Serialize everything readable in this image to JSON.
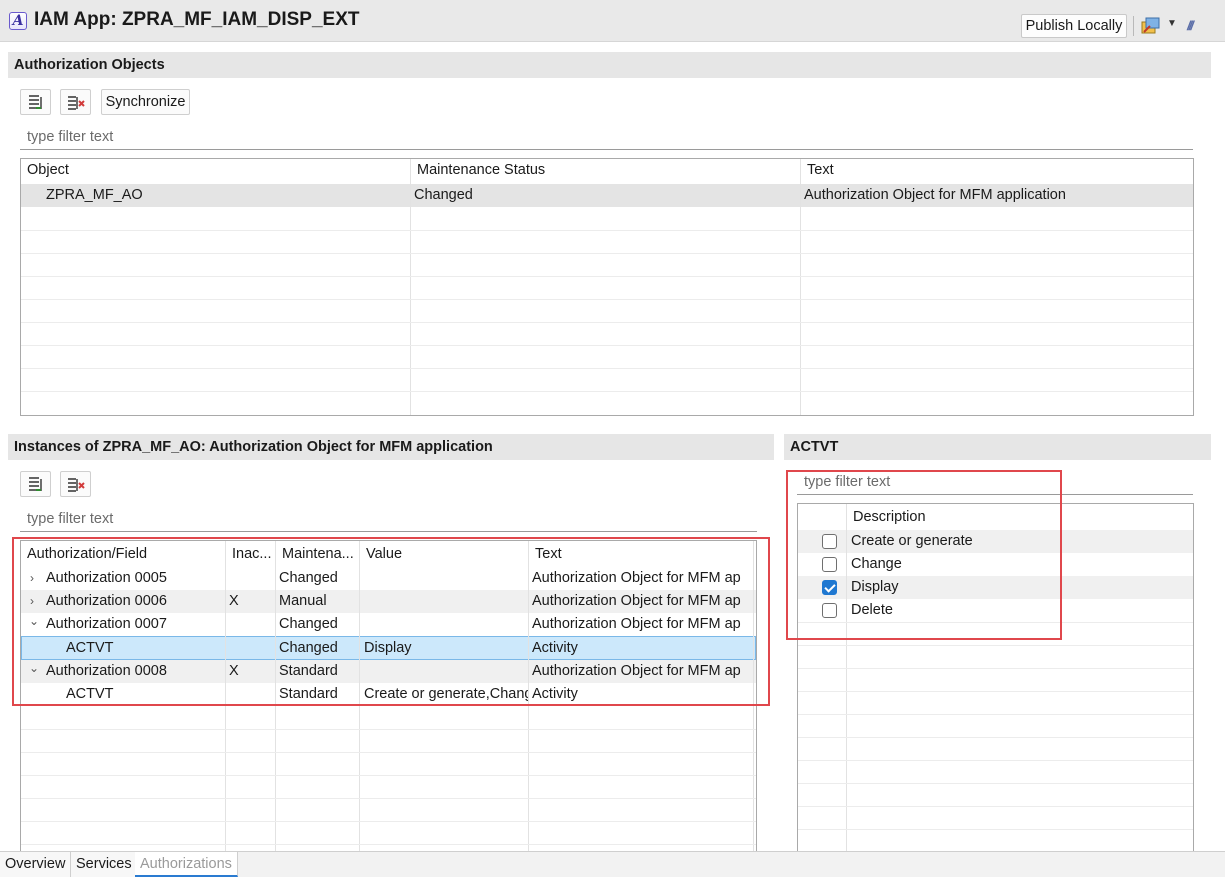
{
  "header": {
    "title": "IAM App: ZPRA_MF_IAM_DISP_EXT",
    "app_icon_letter": "A",
    "publish_label": "Publish Locally"
  },
  "auth_objects": {
    "section_title": "Authorization Objects",
    "synchronize_label": "Synchronize",
    "filter_placeholder": "type filter text",
    "columns": [
      "Object",
      "Maintenance Status",
      "Text"
    ],
    "rows": [
      {
        "object": "ZPRA_MF_AO",
        "status": "Changed",
        "text": "Authorization Object for MFM application"
      }
    ]
  },
  "instances": {
    "section_title": "Instances of ZPRA_MF_AO: Authorization Object for MFM application",
    "filter_placeholder": "type filter text",
    "columns": [
      "Authorization/Field",
      "Inac...",
      "Maintena...",
      "Value",
      "Text"
    ],
    "rows": [
      {
        "chevron": "›",
        "field": "Authorization 0005",
        "inactive": "",
        "status": "Changed",
        "value": "",
        "text": "Authorization Object for MFM ap"
      },
      {
        "chevron": "›",
        "field": "Authorization 0006",
        "inactive": "X",
        "status": "Manual",
        "value": "",
        "text": "Authorization Object for MFM ap"
      },
      {
        "chevron": "⌄",
        "field": "Authorization 0007",
        "inactive": "",
        "status": "Changed",
        "value": "",
        "text": "Authorization Object for MFM ap"
      },
      {
        "chevron": "",
        "field": "ACTVT",
        "inactive": "",
        "status": "Changed",
        "value": "Display",
        "text": "Activity"
      },
      {
        "chevron": "⌄",
        "field": "Authorization 0008",
        "inactive": "X",
        "status": "Standard",
        "value": "",
        "text": "Authorization Object for MFM ap"
      },
      {
        "chevron": "",
        "field": "ACTVT",
        "inactive": "",
        "status": "Standard",
        "value": "Create or generate,Change",
        "text": "Activity"
      }
    ]
  },
  "actvt": {
    "section_title": "ACTVT",
    "filter_placeholder": "type filter text",
    "column": "Description",
    "options": [
      {
        "label": "Create or generate",
        "checked": false
      },
      {
        "label": "Change",
        "checked": false
      },
      {
        "label": "Display",
        "checked": true
      },
      {
        "label": "Delete",
        "checked": false
      }
    ]
  },
  "tabs": [
    "Overview",
    "Services",
    "Authorizations"
  ],
  "colors": {
    "highlight_red": "#e0474c",
    "selection_blue": "#cce8fb",
    "checkbox_blue": "#1f78d1"
  }
}
